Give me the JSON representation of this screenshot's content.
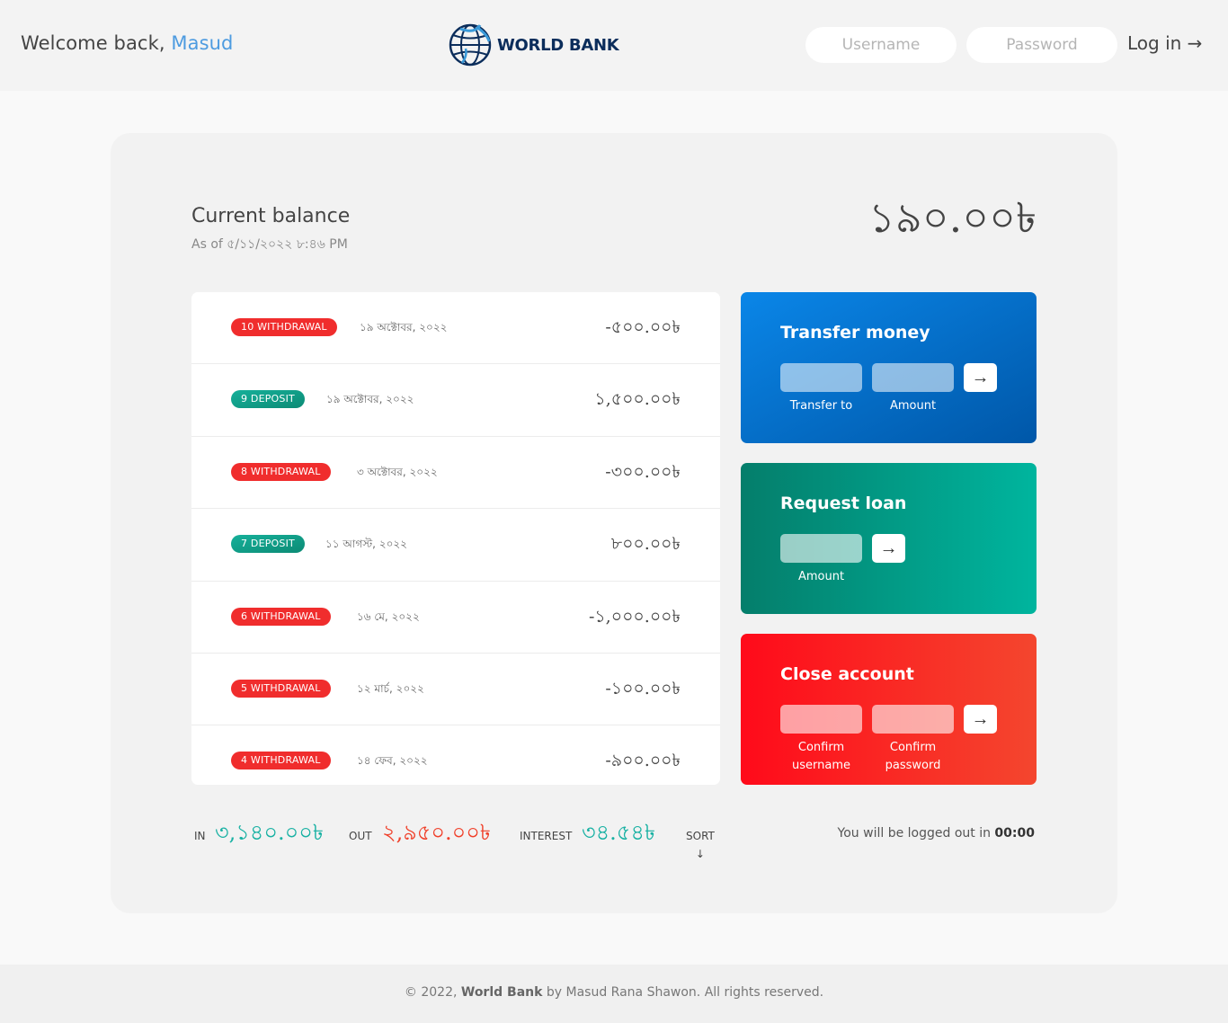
{
  "header": {
    "welcome_prefix": "Welcome back, ",
    "welcome_user": "Masud",
    "logo_text": "WORLD BANK",
    "username_placeholder": "Username",
    "password_placeholder": "Password",
    "login_label": "Log in →"
  },
  "balance": {
    "title": "Current balance",
    "date": "As of ৫/১১/২০২২ ৮:৪৬ PM",
    "value": "১৯০.০০৳"
  },
  "movements": [
    {
      "type": "withdrawal",
      "badge": "10 WITHDRAWAL",
      "date": "১৯ অক্টোবর, ২০২২",
      "value": "-৫০০.০০৳"
    },
    {
      "type": "deposit",
      "badge": "9 DEPOSIT",
      "date": "১৯ অক্টোবর, ২০২২",
      "value": "১,৫০০.০০৳"
    },
    {
      "type": "withdrawal",
      "badge": "8 WITHDRAWAL",
      "date": "৩ অক্টোবর, ২০২২",
      "value": "-৩০০.০০৳"
    },
    {
      "type": "deposit",
      "badge": "7 DEPOSIT",
      "date": "১১ আগস্ট, ২০২২",
      "value": "৮০০.০০৳"
    },
    {
      "type": "withdrawal",
      "badge": "6 WITHDRAWAL",
      "date": "১৬ মে, ২০২২",
      "value": "-১,০০০.০০৳"
    },
    {
      "type": "withdrawal",
      "badge": "5 WITHDRAWAL",
      "date": "১২ মার্চ, ২০২২",
      "value": "-১০০.০০৳"
    },
    {
      "type": "withdrawal",
      "badge": "4 WITHDRAWAL",
      "date": "১৪ ফেব, ২০২২",
      "value": "-৯০০.০০৳"
    }
  ],
  "operations": {
    "transfer": {
      "title": "Transfer money",
      "label_to": "Transfer to",
      "label_amount": "Amount",
      "button": "→"
    },
    "loan": {
      "title": "Request loan",
      "label_amount": "Amount",
      "button": "→"
    },
    "close": {
      "title": "Close account",
      "label_user_1": "Confirm",
      "label_user_2": "username",
      "label_pin_1": "Confirm",
      "label_pin_2": "password",
      "button": "→"
    }
  },
  "summary": {
    "in_label": "In",
    "in_value": "৩,১৪০.০০৳",
    "out_label": "Out",
    "out_value": "২,৯৫০.০০৳",
    "interest_label": "Interest",
    "interest_value": "৩৪.৫৪৳",
    "sort_label": "SORT",
    "sort_arrow": "↓"
  },
  "logout": {
    "prefix": "You will be logged out in ",
    "timer": "00:00"
  },
  "footer": {
    "prefix": "© 2022, ",
    "brand": "World Bank",
    "suffix": " by Masud Rana Shawon. All rights reserved."
  },
  "colors": {
    "accent_blue": "#4d9be0",
    "deposit_green": "#18b1a3",
    "withdrawal_red": "#f0402a",
    "transfer_bg": "#0a6fc9",
    "loan_bg": "#02a08b",
    "close_bg": "#f92521"
  }
}
